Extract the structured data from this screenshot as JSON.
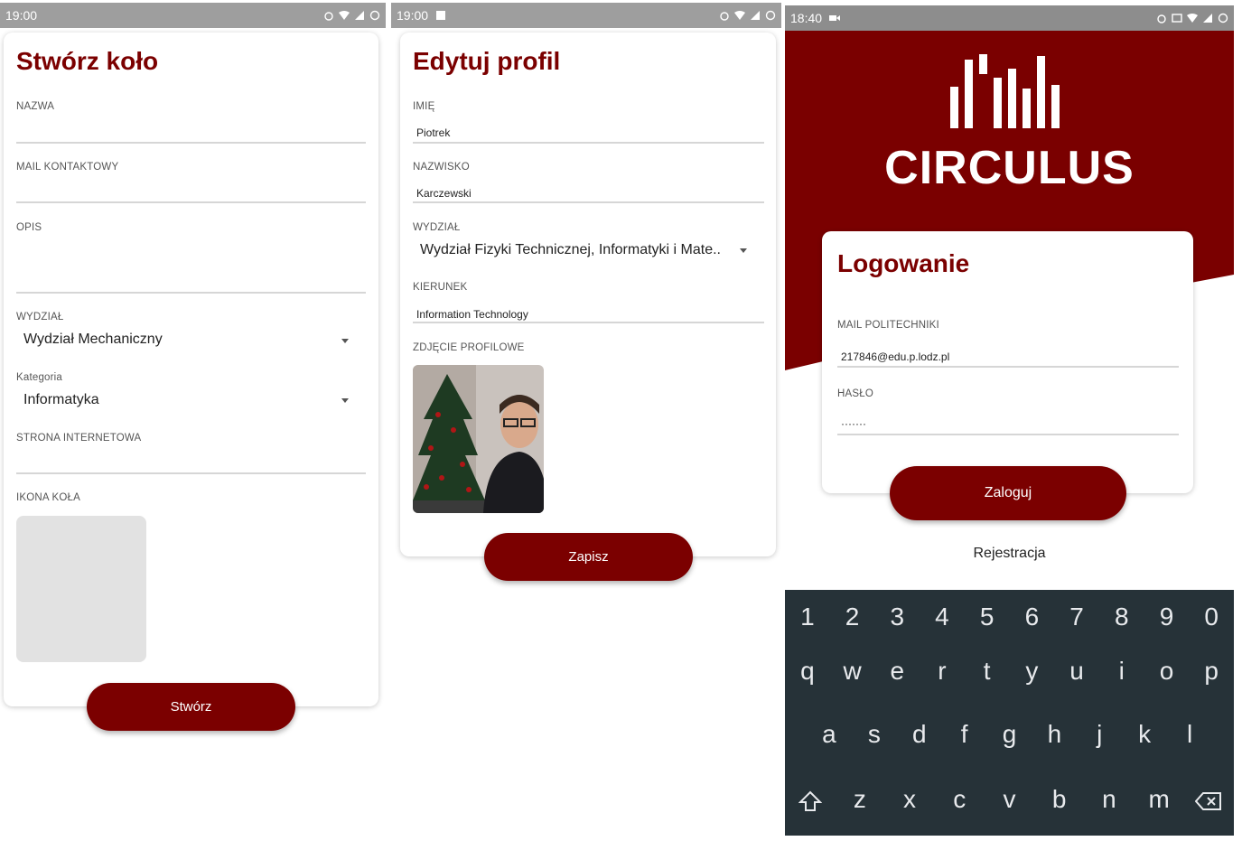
{
  "create_circle": {
    "status_time": "19:00",
    "title": "Stwórz koło",
    "name_label": "NAZWA",
    "mail_label": "MAIL KONTAKTOWY",
    "desc_label": "OPIS",
    "faculty_label": "WYDZIAŁ",
    "faculty_value": "Wydział Mechaniczny",
    "category_label": "Kategoria",
    "category_value": "Informatyka",
    "website_label": "STRONA INTERNETOWA",
    "icon_label": "IKONA KOŁA",
    "create_button": "Stwórz"
  },
  "edit_profile": {
    "status_time": "19:00",
    "title": "Edytuj profil",
    "first_name_label": "IMIĘ",
    "first_name_value": "Piotrek",
    "last_name_label": "NAZWISKO",
    "last_name_value": "Karczewski",
    "faculty_label": "WYDZIAŁ",
    "faculty_value": "Wydział Fizyki Technicznej, Informatyki i Mate..",
    "major_label": "KIERUNEK",
    "major_value": "Information Technology",
    "photo_label": "ZDJĘCIE PROFILOWE",
    "save_button": "Zapisz"
  },
  "login": {
    "status_time": "18:40",
    "brand": "CIRCULUS",
    "title": "Logowanie",
    "email_label": "MAIL POLITECHNIKI",
    "email_value": "217846@edu.p.lodz.pl",
    "password_label": "HASŁO",
    "password_value": "·······",
    "login_button": "Zaloguj",
    "register_link": "Rejestracja",
    "keyboard": {
      "row1": [
        "1",
        "2",
        "3",
        "4",
        "5",
        "6",
        "7",
        "8",
        "9",
        "0"
      ],
      "row2": [
        "q",
        "w",
        "e",
        "r",
        "t",
        "y",
        "u",
        "i",
        "o",
        "p"
      ],
      "row3": [
        "a",
        "s",
        "d",
        "f",
        "g",
        "h",
        "j",
        "k",
        "l"
      ],
      "row4": [
        "z",
        "x",
        "c",
        "v",
        "b",
        "n",
        "m"
      ]
    }
  },
  "colors": {
    "brand": "#7b0000",
    "statusbar": "#9e9e9e",
    "keyboard_bg": "#263238"
  }
}
